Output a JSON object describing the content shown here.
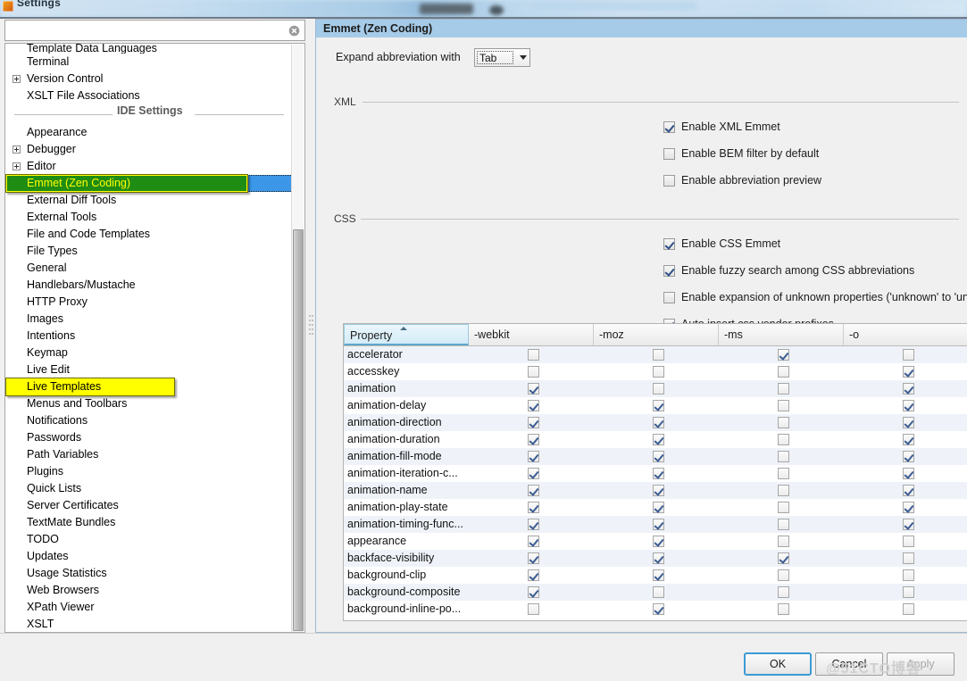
{
  "window": {
    "title": "Settings",
    "icon": "app-icon"
  },
  "search": {
    "value": "",
    "placeholder": "",
    "clear_icon": "clear-circle-icon"
  },
  "sidebar": {
    "items": [
      {
        "label": "Template Data Languages",
        "expandable": false,
        "clipped": true,
        "state": "normal"
      },
      {
        "label": "Terminal",
        "expandable": false,
        "clipped": false,
        "state": "normal"
      },
      {
        "label": "Version Control",
        "expandable": true,
        "clipped": false,
        "state": "normal"
      },
      {
        "label": "XSLT File Associations",
        "expandable": false,
        "clipped": false,
        "state": "normal"
      }
    ],
    "group_separator_label": "IDE Settings",
    "ide_items": [
      {
        "label": "Appearance",
        "expandable": false,
        "state": "normal"
      },
      {
        "label": "Debugger",
        "expandable": true,
        "state": "normal"
      },
      {
        "label": "Editor",
        "expandable": true,
        "state": "normal"
      },
      {
        "label": "Emmet (Zen Coding)",
        "expandable": false,
        "state": "selected-highlighted"
      },
      {
        "label": "External Diff Tools",
        "expandable": false,
        "state": "normal"
      },
      {
        "label": "External Tools",
        "expandable": false,
        "state": "normal"
      },
      {
        "label": "File and Code Templates",
        "expandable": false,
        "state": "normal"
      },
      {
        "label": "File Types",
        "expandable": false,
        "state": "normal"
      },
      {
        "label": "General",
        "expandable": false,
        "state": "normal"
      },
      {
        "label": "Handlebars/Mustache",
        "expandable": false,
        "state": "normal"
      },
      {
        "label": "HTTP Proxy",
        "expandable": false,
        "state": "normal"
      },
      {
        "label": "Images",
        "expandable": false,
        "state": "normal"
      },
      {
        "label": "Intentions",
        "expandable": false,
        "state": "normal"
      },
      {
        "label": "Keymap",
        "expandable": false,
        "state": "normal"
      },
      {
        "label": "Live Edit",
        "expandable": false,
        "state": "normal"
      },
      {
        "label": "Live Templates",
        "expandable": false,
        "state": "highlighted"
      },
      {
        "label": "Menus and Toolbars",
        "expandable": false,
        "state": "normal"
      },
      {
        "label": "Notifications",
        "expandable": false,
        "state": "normal"
      },
      {
        "label": "Passwords",
        "expandable": false,
        "state": "normal"
      },
      {
        "label": "Path Variables",
        "expandable": false,
        "state": "normal"
      },
      {
        "label": "Plugins",
        "expandable": false,
        "state": "normal"
      },
      {
        "label": "Quick Lists",
        "expandable": false,
        "state": "normal"
      },
      {
        "label": "Server Certificates",
        "expandable": false,
        "state": "normal"
      },
      {
        "label": "TextMate Bundles",
        "expandable": false,
        "state": "normal"
      },
      {
        "label": "TODO",
        "expandable": false,
        "state": "normal"
      },
      {
        "label": "Updates",
        "expandable": false,
        "state": "normal"
      },
      {
        "label": "Usage Statistics",
        "expandable": false,
        "state": "normal"
      },
      {
        "label": "Web Browsers",
        "expandable": false,
        "state": "normal"
      },
      {
        "label": "XPath Viewer",
        "expandable": false,
        "state": "normal"
      },
      {
        "label": "XSLT",
        "expandable": false,
        "state": "normal"
      }
    ]
  },
  "panel": {
    "title": "Emmet (Zen Coding)",
    "expand_label": "Expand abbreviation with",
    "expand_value": "Tab",
    "xml_group": {
      "title": "XML",
      "options": [
        {
          "label": "Enable XML Emmet",
          "checked": true
        },
        {
          "label": "Enable BEM filter by default",
          "checked": false
        },
        {
          "label": "Enable abbreviation preview",
          "checked": false
        }
      ]
    },
    "css_group": {
      "title": "CSS",
      "options": [
        {
          "label": "Enable CSS Emmet",
          "checked": true
        },
        {
          "label": "Enable fuzzy search among CSS abbreviations",
          "checked": true
        },
        {
          "label": "Enable expansion of unknown properties ('unknown' to 'unknown: ;')",
          "checked": false
        },
        {
          "label": "Auto insert css vendor prefixes",
          "checked": true
        }
      ]
    }
  },
  "table": {
    "columns": [
      "Property",
      "-webkit",
      "-moz",
      "-ms",
      "-o"
    ],
    "sorted_column": "Property",
    "sort_direction": "ascending",
    "rows": [
      {
        "property": "accelerator",
        "webkit": false,
        "moz": false,
        "ms": true,
        "o": false
      },
      {
        "property": "accesskey",
        "webkit": false,
        "moz": false,
        "ms": false,
        "o": true
      },
      {
        "property": "animation",
        "webkit": true,
        "moz": false,
        "ms": false,
        "o": true
      },
      {
        "property": "animation-delay",
        "webkit": true,
        "moz": true,
        "ms": false,
        "o": true
      },
      {
        "property": "animation-direction",
        "webkit": true,
        "moz": true,
        "ms": false,
        "o": true
      },
      {
        "property": "animation-duration",
        "webkit": true,
        "moz": true,
        "ms": false,
        "o": true
      },
      {
        "property": "animation-fill-mode",
        "webkit": true,
        "moz": true,
        "ms": false,
        "o": true
      },
      {
        "property": "animation-iteration-c...",
        "webkit": true,
        "moz": true,
        "ms": false,
        "o": true
      },
      {
        "property": "animation-name",
        "webkit": true,
        "moz": true,
        "ms": false,
        "o": true
      },
      {
        "property": "animation-play-state",
        "webkit": true,
        "moz": true,
        "ms": false,
        "o": true
      },
      {
        "property": "animation-timing-func...",
        "webkit": true,
        "moz": true,
        "ms": false,
        "o": true
      },
      {
        "property": "appearance",
        "webkit": true,
        "moz": true,
        "ms": false,
        "o": false
      },
      {
        "property": "backface-visibility",
        "webkit": true,
        "moz": true,
        "ms": true,
        "o": false
      },
      {
        "property": "background-clip",
        "webkit": true,
        "moz": true,
        "ms": false,
        "o": false
      },
      {
        "property": "background-composite",
        "webkit": true,
        "moz": false,
        "ms": false,
        "o": false
      },
      {
        "property": "background-inline-po...",
        "webkit": false,
        "moz": true,
        "ms": false,
        "o": false
      }
    ]
  },
  "footer": {
    "ok": "OK",
    "cancel": "Cancel",
    "apply": "Apply"
  },
  "watermark": "@51CTO博客",
  "colors": {
    "panel_header": "#a6cbe8",
    "selection_blue": "#3d97e8",
    "highlight_yellow": "#ffff00",
    "highlight_green": "#1f8c14",
    "row_stripe": "#eff3f9"
  }
}
